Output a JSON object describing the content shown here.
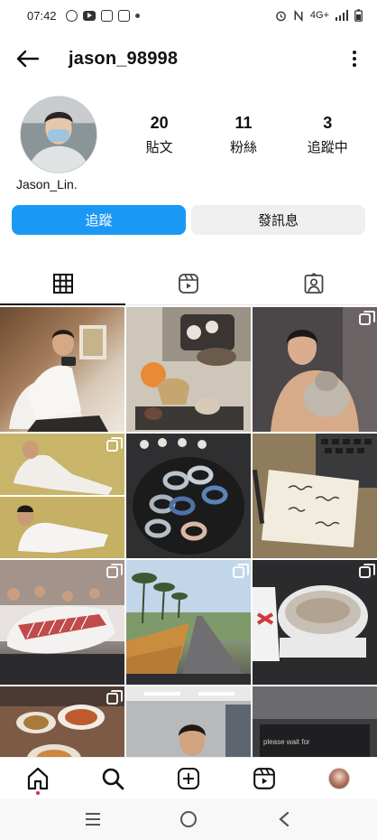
{
  "status_bar": {
    "time": "07:42",
    "network": "4G+",
    "left_icons": [
      "messenger-icon",
      "youtube-icon",
      "instagram-icon",
      "instagram-icon",
      "dot-icon"
    ],
    "right_icons": [
      "alarm-icon",
      "nfc-icon",
      "network-icon",
      "signal-icon",
      "battery-icon"
    ]
  },
  "header": {
    "username": "jason_98998"
  },
  "profile": {
    "display_name": "Jason_Lin.",
    "stats": [
      {
        "value": "20",
        "label": "貼文"
      },
      {
        "value": "11",
        "label": "粉絲"
      },
      {
        "value": "3",
        "label": "追蹤中"
      }
    ]
  },
  "actions": {
    "follow_label": "追蹤",
    "message_label": "發訊息"
  },
  "tabs": [
    "grid-icon",
    "reels-icon",
    "tagged-icon"
  ],
  "grid": {
    "tiles": [
      {
        "subject": "man sitting with camera",
        "multi": false
      },
      {
        "subject": "tea set on table",
        "multi": false
      },
      {
        "subject": "man holding cat",
        "multi": true
      },
      {
        "subject": "man on grass",
        "multi": true
      },
      {
        "subject": "watches in tray",
        "multi": false
      },
      {
        "subject": "handwritten note on laptop",
        "multi": false
      },
      {
        "subject": "dinner with friends",
        "multi": true
      },
      {
        "subject": "road with palm trees",
        "multi": true
      },
      {
        "subject": "food container",
        "multi": true
      },
      {
        "subject": "meal on table",
        "multi": true
      },
      {
        "subject": "man at gym",
        "multi": false
      },
      {
        "subject": "laptop screen",
        "multi": false
      }
    ],
    "laptop_text": "please wait for"
  },
  "bottom_nav": [
    "home-icon",
    "search-icon",
    "create-icon",
    "reels-icon",
    "profile-avatar"
  ],
  "colors": {
    "accent": "#1a99f4",
    "secondary_button": "#efefef",
    "text": "#111111"
  }
}
